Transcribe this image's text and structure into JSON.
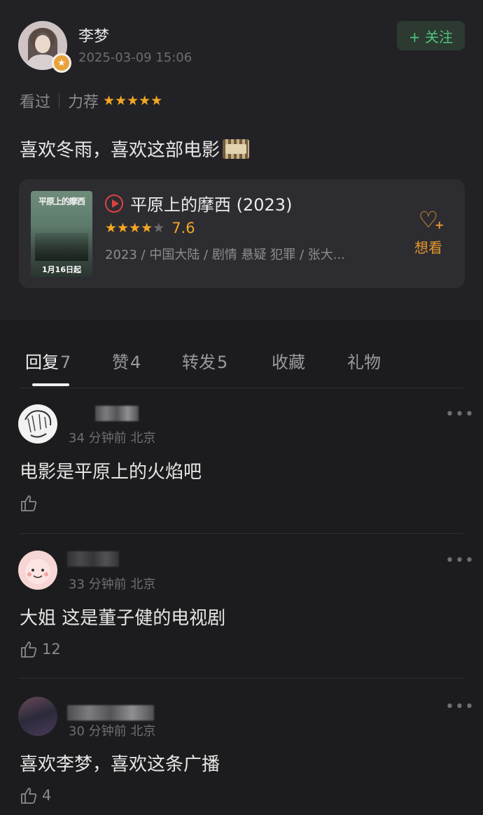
{
  "post": {
    "username": "李梦",
    "timestamp": "2025-03-09 15:06",
    "follow_label": "+ 关注",
    "status": "看过",
    "recommend": "力荐",
    "stars": "★★★★★",
    "text": "喜欢冬雨，喜欢这部电影"
  },
  "movie": {
    "poster_title": "平原上的摩西",
    "poster_date": "1月16日起",
    "title": "平原上的摩西 (2023)",
    "stars_on": "★★★★",
    "stars_off": "★",
    "score": "7.6",
    "meta": "2023 / 中国大陆 / 剧情 悬疑 犯罪 / 张大...",
    "want_label": "想看"
  },
  "tabs": [
    {
      "label": "回复",
      "count": "7"
    },
    {
      "label": "赞",
      "count": "4"
    },
    {
      "label": "转发",
      "count": "5"
    },
    {
      "label": "收藏",
      "count": ""
    },
    {
      "label": "礼物",
      "count": ""
    }
  ],
  "comments": [
    {
      "time": "34 分钟前 北京",
      "text": "电影是平原上的火焰吧",
      "likes": "",
      "more": "•••"
    },
    {
      "time": "33 分钟前 北京",
      "text": "大姐 这是董子健的电视剧",
      "likes": "12",
      "more": "•••"
    },
    {
      "time": "30 分钟前 北京",
      "text": "喜欢李梦，喜欢这条广播",
      "likes": "4",
      "more": "•••"
    }
  ],
  "colors": {
    "accent": "#f5a623",
    "follow": "#4fc27a",
    "want": "#e8962f"
  }
}
